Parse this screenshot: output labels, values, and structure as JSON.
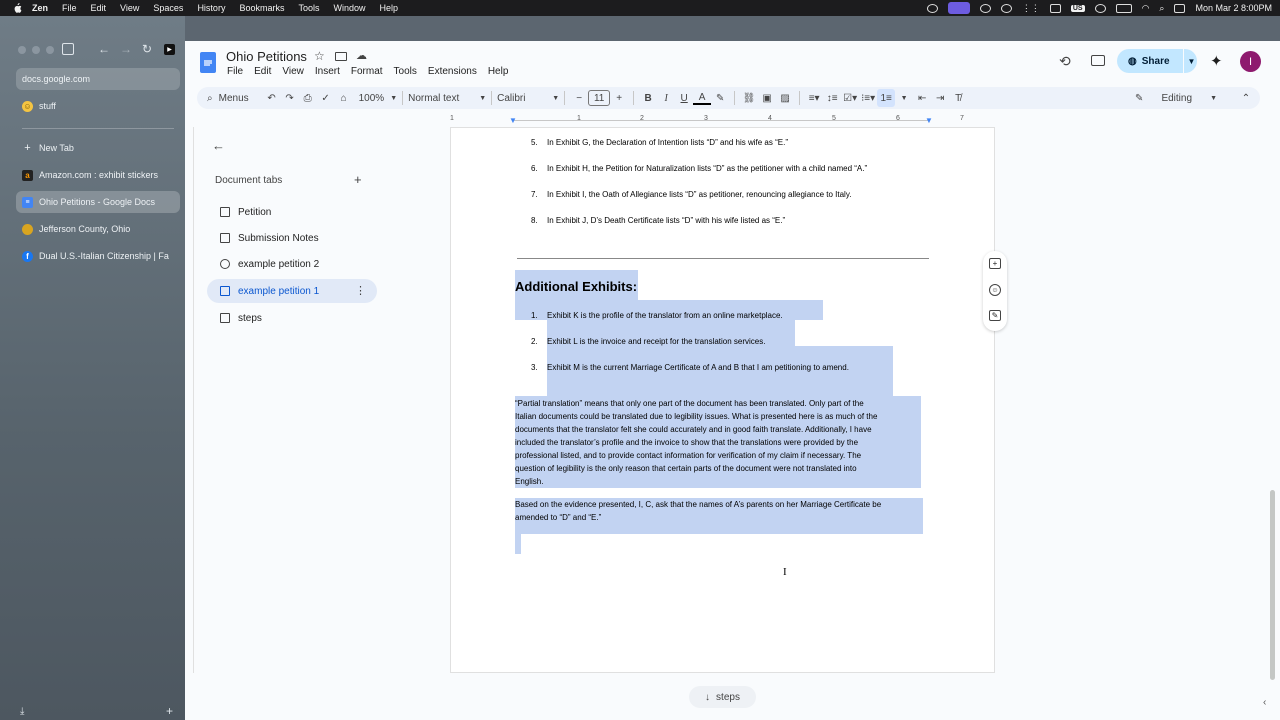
{
  "menubar": {
    "app": "Zen",
    "items": [
      "File",
      "Edit",
      "View",
      "Spaces",
      "History",
      "Bookmarks",
      "Tools",
      "Window",
      "Help"
    ],
    "clock": "Mon Mar 2  8:00PM",
    "input_source": "US"
  },
  "browser": {
    "url": "docs.google.com",
    "pinned": "stuff",
    "new_tab": "New Tab",
    "tabs": [
      {
        "label": "Amazon.com : exhibit stickers",
        "icon": "amazon-icon",
        "color": "#222222"
      },
      {
        "label": "Ohio Petitions - Google Docs",
        "icon": "docs-icon",
        "color": "#4285f4",
        "active": true
      },
      {
        "label": "Jefferson County, Ohio",
        "icon": "seal-icon",
        "color": "#d9a520"
      },
      {
        "label": "Dual U.S.-Italian Citizenship | Fa",
        "icon": "facebook-icon",
        "color": "#1877f2"
      }
    ]
  },
  "doc": {
    "title": "Ohio Petitions",
    "menus": [
      "File",
      "Edit",
      "View",
      "Insert",
      "Format",
      "Tools",
      "Extensions",
      "Help"
    ],
    "share": "Share",
    "avatar": "I",
    "toolbar": {
      "search": "Menus",
      "zoom": "100%",
      "style": "Normal text",
      "font": "Calibri",
      "size": "11",
      "mode": "Editing"
    },
    "ruler": [
      "1",
      "1",
      "2",
      "3",
      "4",
      "5",
      "6",
      "7"
    ],
    "tabs_panel": {
      "heading": "Document tabs",
      "items": [
        "Petition",
        "Submission Notes",
        "example petition 2",
        "example petition 1",
        "steps"
      ],
      "active": "example petition 1"
    },
    "next_tab": "steps"
  },
  "content": {
    "list1": [
      {
        "n": "5.",
        "text": "In Exhibit G, the Declaration of Intention lists “D” and his wife as “E.”"
      },
      {
        "n": "6.",
        "text": "In Exhibit H, the Petition for Naturalization lists “D” as the petitioner with a child named “A.”"
      },
      {
        "n": "7.",
        "text": "In Exhibit I, the Oath of Allegiance lists “D” as petitioner, renouncing allegiance to Italy."
      },
      {
        "n": "8.",
        "text": "In Exhibit J, D’s Death Certificate lists “D” with his wife listed as “E.”"
      }
    ],
    "heading": "Additional Exhibits:",
    "list2": [
      {
        "n": "1.",
        "text": "Exhibit K is the profile of the translator from an online marketplace."
      },
      {
        "n": "2.",
        "text": "Exhibit L is the invoice and receipt for the translation services."
      },
      {
        "n": "3.",
        "text": "Exhibit M is the current Marriage Certificate of A and B that I am petitioning to amend."
      }
    ],
    "para1": [
      "“Partial translation” means that only one part of the document has been translated. Only part of the",
      "Italian documents could be translated due to legibility issues. What is presented here is as much of the",
      "documents that the translator felt she could accurately and in good faith translate. Additionally, I have",
      "included the translator’s profile and the invoice to show that the translations were provided by the",
      "professional listed, and to provide contact information for verification of my claim if necessary. The",
      "question of legibility is the only reason that certain parts of the document were not translated into",
      "English."
    ],
    "para2": [
      "Based on the evidence presented, I, C, ask that the names of A’s parents on her Marriage Certificate be",
      "amended to “D” and “E.”"
    ]
  },
  "colors": {
    "accent": "#0b57d0",
    "selection": "#c2d3f2",
    "share_bg": "#c2e7ff",
    "active_tab_bg": "#e1e9f7"
  }
}
